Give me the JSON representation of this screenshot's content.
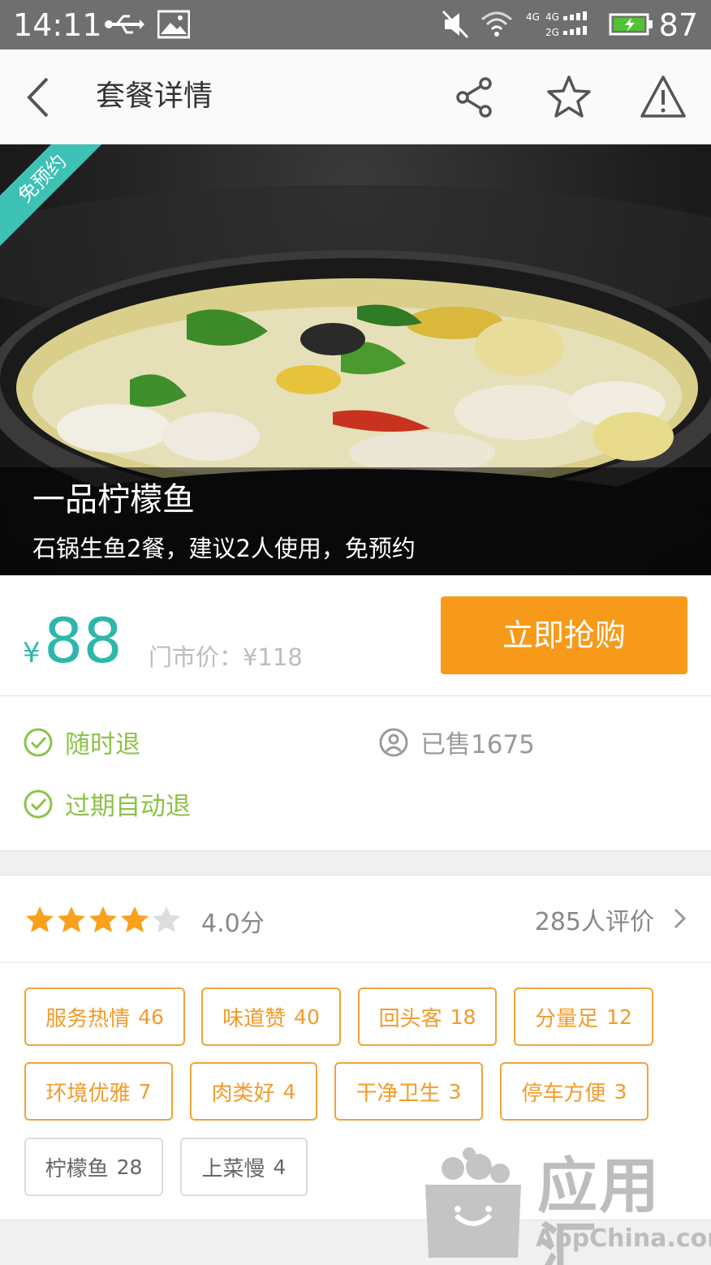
{
  "status_bar": {
    "time": "14:11",
    "battery": "87",
    "network": "4G 4G 2G"
  },
  "app_bar": {
    "title": "套餐详情",
    "icons": [
      "back-icon",
      "share-icon",
      "star-outline-icon",
      "warning-icon"
    ]
  },
  "hero": {
    "badge": "免预约",
    "dish_name": "一品柠檬鱼",
    "description": "石锅生鱼2餐，建议2人使用，免预约"
  },
  "price": {
    "currency": "¥",
    "value": "88",
    "original": "门市价：¥118",
    "buy_label": "立即抢购",
    "accent": "#2bb8aa",
    "button_color": "#f79a19"
  },
  "guarantees": {
    "refund_anytime": "随时退",
    "sold": "已售1675",
    "refund_expired": "过期自动退"
  },
  "rating": {
    "stars": 4,
    "max_stars": 5,
    "score": "4.0分",
    "reviews": "285人评价"
  },
  "tags": [
    {
      "label": "服务热情",
      "count": "46"
    },
    {
      "label": "味道赞",
      "count": "40"
    },
    {
      "label": "回头客",
      "count": "18"
    },
    {
      "label": "分量足",
      "count": "12"
    },
    {
      "label": "环境优雅",
      "count": "7"
    },
    {
      "label": "肉类好",
      "count": "4"
    },
    {
      "label": "干净卫生",
      "count": "3"
    },
    {
      "label": "停车方便",
      "count": "3"
    },
    {
      "label": "柠檬鱼",
      "count": "28"
    },
    {
      "label": "上菜慢",
      "count": "4"
    }
  ],
  "watermark": {
    "name": "应用汇",
    "domain": "AppChina.com"
  }
}
